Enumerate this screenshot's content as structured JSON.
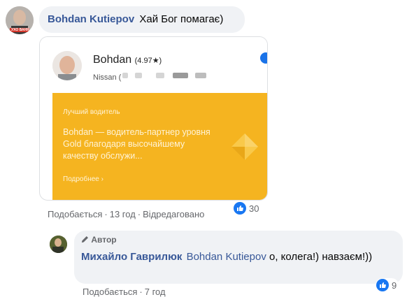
{
  "comment1": {
    "author": "Bohdan Kutiepov",
    "text": "Хай Бог помагає)",
    "avatar_caption": "УХО ВАНЯ"
  },
  "card": {
    "driver_name": "Bohdan",
    "rating": "(4.97★)",
    "car": "Nissan (",
    "badge_title": "Лучший водитель",
    "description": "Bohdan — водитель-партнер уровня Gold благодаря высочайшему качеству обслужи...",
    "more_link": "Подробнее ›"
  },
  "comment1_actions": {
    "like": "Подобається",
    "time": "13 год",
    "edited": "Відредаговано",
    "reaction_count": "30"
  },
  "reply": {
    "author_badge": "Автор",
    "author": "Михайло Гаврилюк",
    "mention": "Bohdan Kutiepov",
    "text": "о, колега!) навзаєм!))",
    "like": "Подобається",
    "time": "7 год",
    "reaction_count": "9"
  },
  "colors": {
    "link": "#385898",
    "bubble": "#f0f2f5",
    "card_yellow": "#f5b420",
    "like_blue": "#1877f2"
  }
}
